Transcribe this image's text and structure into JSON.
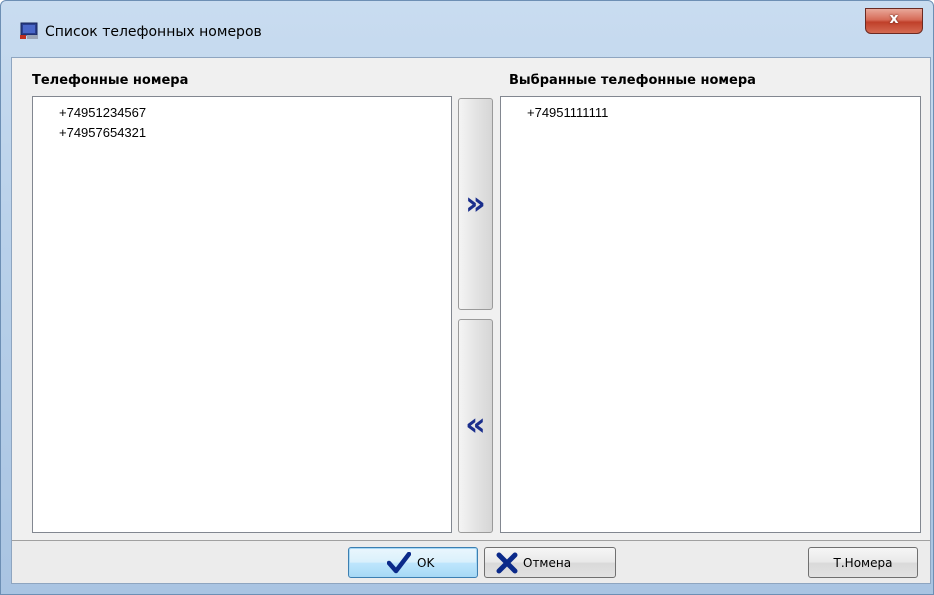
{
  "window": {
    "title": "Список телефонных номеров",
    "close_label": "x"
  },
  "left_panel": {
    "label": "Телефонные номера",
    "items": [
      "+74951234567",
      "+74957654321"
    ]
  },
  "right_panel": {
    "label": "Выбранные телефонные номера",
    "items": [
      "+74951111111"
    ]
  },
  "move_buttons": {
    "add_glyph": "»",
    "remove_glyph": "«"
  },
  "buttons": {
    "ok_label": "OK",
    "cancel_label": "Отмена",
    "numbers_label": "Т.Номера"
  },
  "colors": {
    "arrow": "#1a2e8c",
    "check": "#0b2a8a"
  }
}
